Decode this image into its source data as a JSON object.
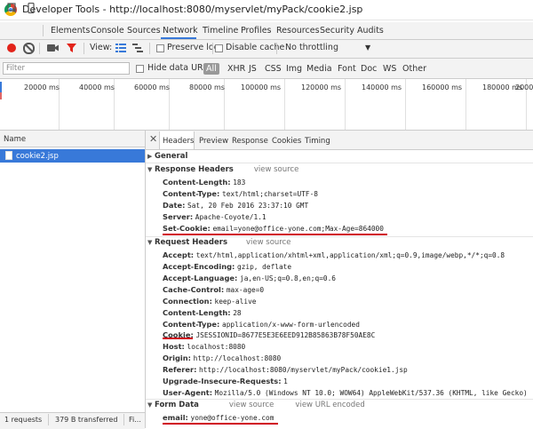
{
  "window": {
    "title": "Developer Tools - http://localhost:8080/myservlet/myPack/cookie2.jsp"
  },
  "tabs": [
    "Elements",
    "Console",
    "Sources",
    "Network",
    "Timeline",
    "Profiles",
    "Resources",
    "Security",
    "Audits"
  ],
  "active_tab": "Network",
  "toolbar": {
    "view_label": "View:",
    "preserve_log": "Preserve log",
    "disable_cache": "Disable cache",
    "throttling": "No throttling"
  },
  "filter": {
    "placeholder": "Filter",
    "hide_data_urls": "Hide data URLs",
    "types": [
      "All",
      "XHR",
      "JS",
      "CSS",
      "Img",
      "Media",
      "Font",
      "Doc",
      "WS",
      "Other"
    ]
  },
  "overview": {
    "ticks": [
      "20000 ms",
      "40000 ms",
      "60000 ms",
      "80000 ms",
      "100000 ms",
      "120000 ms",
      "140000 ms",
      "160000 ms",
      "180000 ms",
      "2000"
    ]
  },
  "requests": {
    "header": "Name",
    "items": [
      "cookie2.jsp"
    ]
  },
  "status": {
    "requests": "1 requests",
    "transferred": "379 B transferred",
    "finish": "Fi..."
  },
  "detail": {
    "tabs": [
      "Headers",
      "Preview",
      "Response",
      "Cookies",
      "Timing"
    ],
    "general": "General",
    "response_headers": {
      "title": "Response Headers",
      "view_source": "view source",
      "items": [
        {
          "k": "Content-Length:",
          "v": "183"
        },
        {
          "k": "Content-Type:",
          "v": "text/html;charset=UTF-8"
        },
        {
          "k": "Date:",
          "v": "Sat, 20 Feb 2016 23:37:10 GMT"
        },
        {
          "k": "Server:",
          "v": "Apache-Coyote/1.1"
        },
        {
          "k": "Set-Cookie:",
          "v": "email=yone@office-yone.com;Max-Age=864000"
        }
      ]
    },
    "request_headers": {
      "title": "Request Headers",
      "view_source": "view source",
      "items": [
        {
          "k": "Accept:",
          "v": "text/html,application/xhtml+xml,application/xml;q=0.9,image/webp,*/*;q=0.8"
        },
        {
          "k": "Accept-Encoding:",
          "v": "gzip, deflate"
        },
        {
          "k": "Accept-Language:",
          "v": "ja,en-US;q=0.8,en;q=0.6"
        },
        {
          "k": "Cache-Control:",
          "v": "max-age=0"
        },
        {
          "k": "Connection:",
          "v": "keep-alive"
        },
        {
          "k": "Content-Length:",
          "v": "28"
        },
        {
          "k": "Content-Type:",
          "v": "application/x-www-form-urlencoded"
        },
        {
          "k": "Cookie:",
          "v": "JSESSIONID=8677E5E3E6EED912B85863B78F50AE8C"
        },
        {
          "k": "Host:",
          "v": "localhost:8080"
        },
        {
          "k": "Origin:",
          "v": "http://localhost:8080"
        },
        {
          "k": "Referer:",
          "v": "http://localhost:8080/myservlet/myPack/cookie1.jsp"
        },
        {
          "k": "Upgrade-Insecure-Requests:",
          "v": "1"
        },
        {
          "k": "User-Agent:",
          "v": "Mozilla/5.0 (Windows NT 10.0; WOW64) AppleWebKit/537.36 (KHTML, like Gecko)"
        }
      ]
    },
    "form_data": {
      "title": "Form Data",
      "view_source": "view source",
      "view_url_encoded": "view URL encoded",
      "items": [
        {
          "k": "email:",
          "v": "yone@office-yone.com"
        }
      ]
    }
  }
}
